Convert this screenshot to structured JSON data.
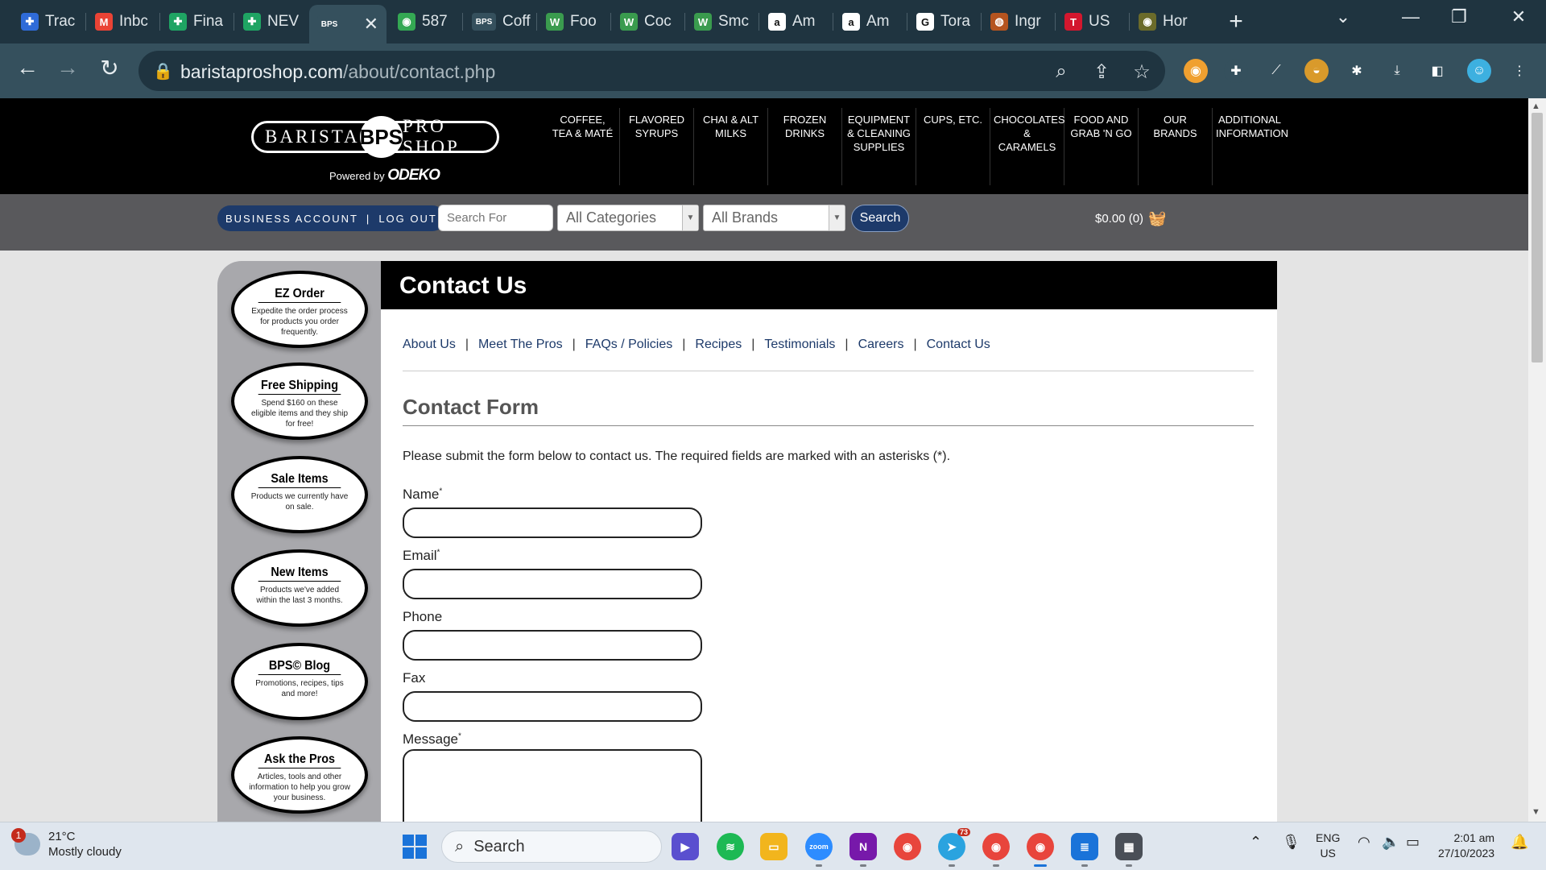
{
  "browser": {
    "tabs": [
      {
        "label": "Trac",
        "icon_color": "#2f6bd8",
        "glyph": "✚"
      },
      {
        "label": "Inbc",
        "icon_color": "#ea4335",
        "glyph": "M"
      },
      {
        "label": "Fina",
        "icon_color": "#1fa463",
        "glyph": "✚"
      },
      {
        "label": "NEV",
        "icon_color": "#1fa463",
        "glyph": "✚"
      },
      {
        "label": "BPS",
        "icon_color": "#35505d",
        "glyph": "BPS"
      },
      {
        "label": "587",
        "icon_color": "#34a853",
        "glyph": "◉"
      },
      {
        "label": "Coff",
        "icon_color": "#35505d",
        "glyph": "BPS"
      },
      {
        "label": "Foo",
        "icon_color": "#3a9b4e",
        "glyph": "W"
      },
      {
        "label": "Coc",
        "icon_color": "#3a9b4e",
        "glyph": "W"
      },
      {
        "label": "Smc",
        "icon_color": "#3a9b4e",
        "glyph": "W"
      },
      {
        "label": "Am",
        "icon_color": "#ffffff",
        "glyph": "a"
      },
      {
        "label": "Am",
        "icon_color": "#ffffff",
        "glyph": "a"
      },
      {
        "label": "Tora",
        "icon_color": "#ffffff",
        "glyph": "G"
      },
      {
        "label": "Ingr",
        "icon_color": "#b5541f",
        "glyph": "◍"
      },
      {
        "label": "US",
        "icon_color": "#d3172e",
        "glyph": "T"
      },
      {
        "label": "Hor",
        "icon_color": "#6b6b2a",
        "glyph": "◉"
      }
    ],
    "url_host": "baristaproshop.com",
    "url_path": "/about/contact.php"
  },
  "site": {
    "logo_left": "BARISTA",
    "logo_mid": "BPS",
    "logo_right": "PRO SHOP",
    "powered_by": "Powered by",
    "powered_brand": "ODEKO",
    "nav": [
      "COFFEE, TEA & MATÉ",
      "FLAVORED SYRUPS",
      "CHAI & ALT MILKS",
      "FROZEN DRINKS",
      "EQUIPMENT & CLEANING SUPPLIES",
      "CUPS, ETC.",
      "CHOCOLATES & CARAMELS",
      "FOOD AND GRAB 'N GO",
      "OUR BRANDS",
      "ADDITIONAL INFORMATION"
    ],
    "account_label": "BUSINESS ACCOUNT",
    "logout_label": "LOG OUT",
    "search_placeholder": "Search For",
    "categories_value": "All Categories",
    "brands_value": "All Brands",
    "search_button": "Search",
    "cart_text": "$0.00 (0)"
  },
  "sidebar": [
    {
      "title": "EZ Order",
      "desc": "Expedite the order process for products you order frequently."
    },
    {
      "title": "Free Shipping",
      "desc": "Spend $160 on these eligible items and they ship for free!"
    },
    {
      "title": "Sale Items",
      "desc": "Products we currently have on sale."
    },
    {
      "title": "New Items",
      "desc": "Products we've added within the last 3 months."
    },
    {
      "title": "BPS© Blog",
      "desc": "Promotions, recipes, tips and more!"
    },
    {
      "title": "Ask the Pros",
      "desc": "Articles, tools and other information to help you grow your business."
    }
  ],
  "content": {
    "heading": "Contact Us",
    "subnav": [
      "About Us",
      "Meet The Pros",
      "FAQs / Policies",
      "Recipes",
      "Testimonials",
      "Careers",
      "Contact Us"
    ],
    "form_title": "Contact Form",
    "intro": "Please submit the form below to contact us. The required fields are marked with an asterisks (*).",
    "fields": {
      "name": "Name",
      "email": "Email",
      "phone": "Phone",
      "fax": "Fax",
      "message": "Message"
    },
    "required_mark": "*"
  },
  "taskbar": {
    "temperature": "21°C",
    "condition": "Mostly cloudy",
    "weather_badge": "1",
    "search_label": "Search",
    "lang_top": "ENG",
    "lang_bottom": "US",
    "time": "2:01 am",
    "date": "27/10/2023",
    "telegram_badge": "73"
  }
}
